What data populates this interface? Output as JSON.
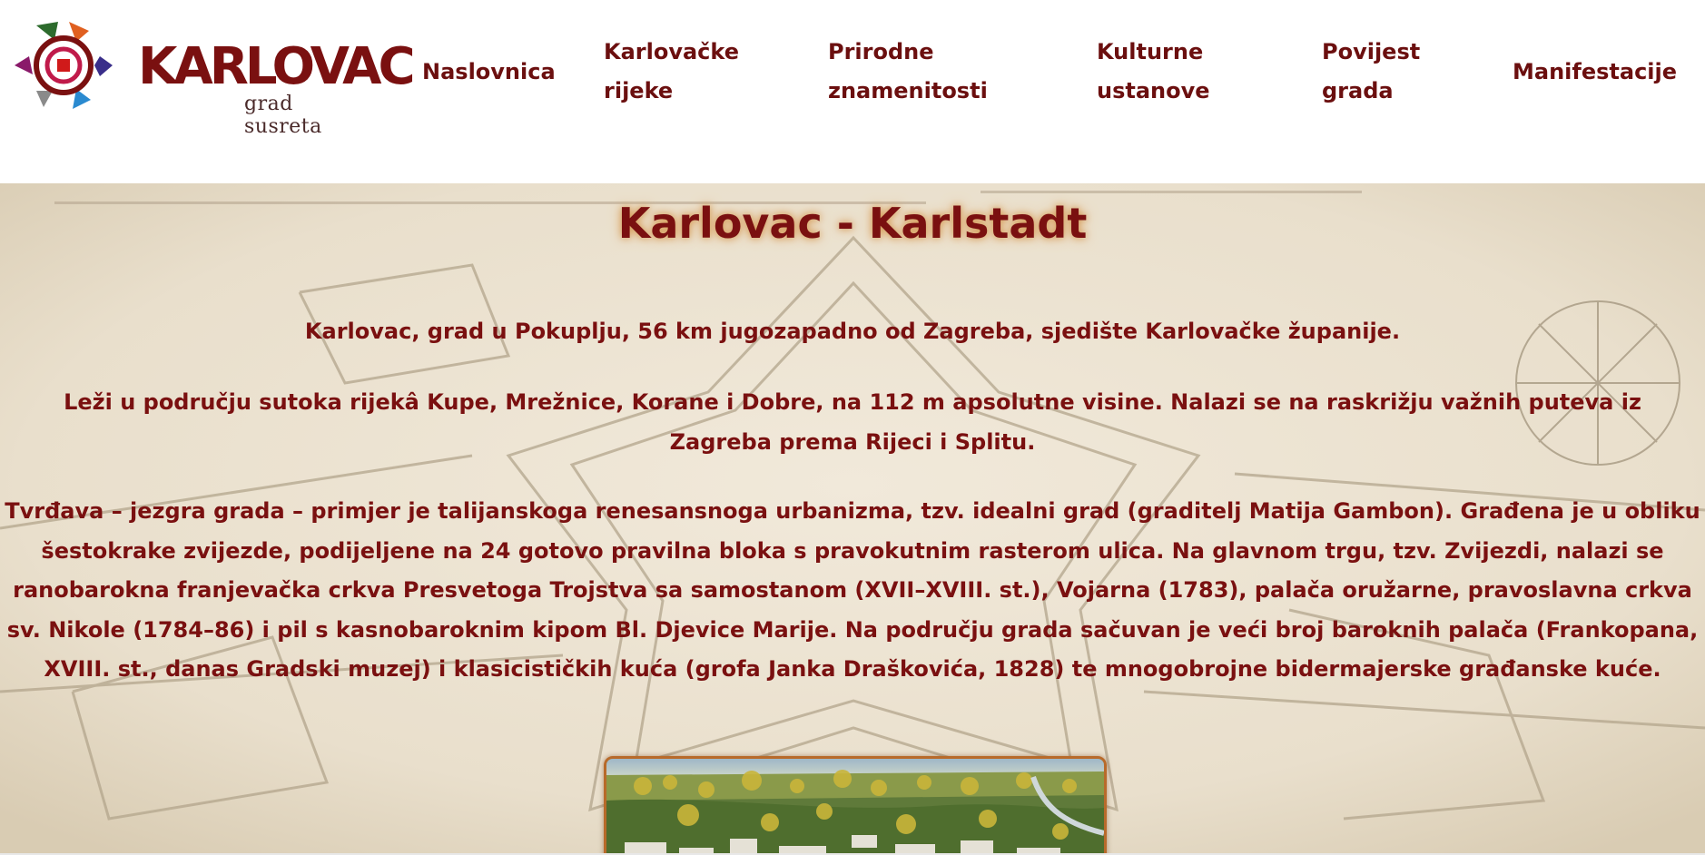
{
  "header": {
    "logo_text": "KARLOVAC",
    "logo_tagline": "grad susreta"
  },
  "nav": {
    "items": [
      {
        "label": "Naslovnica"
      },
      {
        "label_line1": "Karlovačke",
        "label_line2": "rijeke"
      },
      {
        "label_line1": "Prirodne",
        "label_line2": "znamenitosti"
      },
      {
        "label_line1": "Kulturne",
        "label_line2": "ustanove"
      },
      {
        "label_line1": "Povijest",
        "label_line2": "grada"
      },
      {
        "label": "Manifestacije"
      }
    ]
  },
  "main": {
    "title": "Karlovac - Karlstadt",
    "paragraph1": "Karlovac, grad u Pokuplju, 56 km jugozapadno od Zagreba, sjedište Karlovačke županije.",
    "paragraph2": "Leži u području sutoka rijekâ Kupe, Mrežnice, Korane i Dobre, na 112 m apsolutne visine. Nalazi se na raskrižju važnih puteva iz Zagreba prema Rijeci i Splitu.",
    "paragraph3": "Tvrđava – jezgra grada – primjer je talijanskoga renesansnoga urbanizma, tzv. idealni grad (graditelj Matija Gambon). Građena je u obliku šestokrake zvijezde, podijeljene na 24 gotovo pravilna bloka s pravokutnim rasterom ulica. Na glavnom trgu, tzv. Zvijezdi, nalazi se ranobarokna franjevačka crkva Presvetoga Trojstva sa samostanom (XVII–XVIII. st.), Vojarna (1783), palača oružarne, pravoslavna crkva sv. Nikole (1784–86) i pil s kasnobaroknim kipom Bl. Djevice Marije. Na području grada sačuvan je veći broj baroknih palača (Frankopana, XVIII. st., danas Gradski muzej) i klasicističkih kuća (grofa Janka Draškovića, 1828) te mnogobrojne bidermajerske građanske kuće."
  },
  "colors": {
    "text": "#7a1010",
    "map_background": "#ece3d3",
    "photo_border": "#b86a2a"
  }
}
